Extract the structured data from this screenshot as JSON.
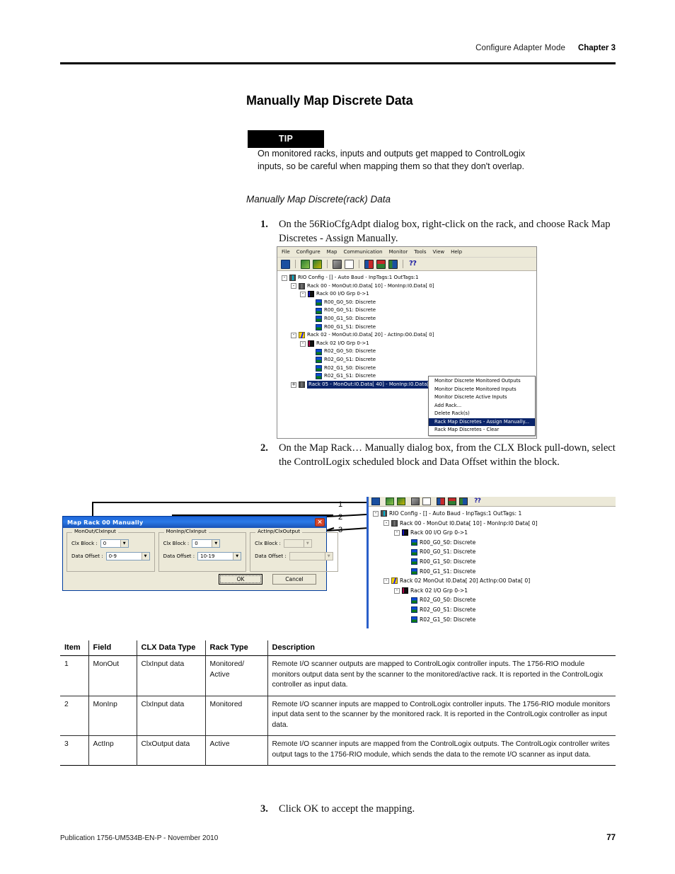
{
  "header": {
    "section": "Configure Adapter Mode",
    "chapter": "Chapter 3"
  },
  "page_title": "Manually Map Discrete Data",
  "tip": {
    "badge": "TIP",
    "text": "On monitored racks, inputs and outputs get mapped to ControlLogix inputs, so be careful when mapping them so that they don't overlap."
  },
  "subhead": "Manually Map Discrete(rack) Data",
  "steps": [
    {
      "num": "1.",
      "text": "On the 56RioCfgAdpt dialog box, right-click on the rack, and choose Rack Map Discretes - Assign Manually."
    },
    {
      "num": "2.",
      "text": "On the Map Rack… Manually dialog box, from the CLX Block pull-down, select the ControlLogix scheduled block and Data Offset within the block."
    },
    {
      "num": "3.",
      "text": "Click OK to accept the mapping."
    }
  ],
  "figure1": {
    "menus": [
      "File",
      "Configure",
      "Map",
      "Communication",
      "Monitor",
      "Tools",
      "View",
      "Help"
    ],
    "toolbar_icons": [
      "save-icon",
      "map-in-icon",
      "map-out-icon",
      "tools-icon",
      "report-icon",
      "monitor-in-icon",
      "monitor-out-icon",
      "connect-icon",
      "help-pointer-icon"
    ],
    "tree": [
      {
        "depth": 0,
        "expander": "-",
        "icon": "root",
        "label": "RIO Config - [] - Auto Baud - InpTags:1 OutTags:1"
      },
      {
        "depth": 1,
        "expander": "-",
        "icon": "rack",
        "label": "Rack 00 - MonOut:I0.Data[ 10] - MonInp:I0.Data[  0]"
      },
      {
        "depth": 2,
        "expander": "-",
        "icon": "grp",
        "label": "Rack 00 I/O Grp 0->1"
      },
      {
        "depth": 3,
        "expander": "",
        "icon": "disc",
        "label": "R00_G0_S0: Discrete"
      },
      {
        "depth": 3,
        "expander": "",
        "icon": "disc",
        "label": "R00_G0_S1: Discrete"
      },
      {
        "depth": 3,
        "expander": "",
        "icon": "disc",
        "label": "R00_G1_S0: Discrete"
      },
      {
        "depth": 3,
        "expander": "",
        "icon": "disc",
        "label": "R00_G1_S1: Discrete"
      },
      {
        "depth": 1,
        "expander": "-",
        "icon": "active",
        "label": "Rack 02 - MonOut:I0.Data[ 20] - ActInp:O0.Data[  0]"
      },
      {
        "depth": 2,
        "expander": "-",
        "icon": "grp-r",
        "label": "Rack 02 I/O Grp 0->1"
      },
      {
        "depth": 3,
        "expander": "",
        "icon": "disc",
        "label": "R02_G0_S0: Discrete"
      },
      {
        "depth": 3,
        "expander": "",
        "icon": "disc",
        "label": "R02_G0_S1: Discrete"
      },
      {
        "depth": 3,
        "expander": "",
        "icon": "disc",
        "label": "R02_G1_S0: Discrete"
      },
      {
        "depth": 3,
        "expander": "",
        "icon": "disc",
        "label": "R02_G1_S1: Discrete"
      },
      {
        "depth": 1,
        "expander": "+",
        "icon": "rack",
        "label": "Rack 05 - MonOut:I0.Data[ 40] - MonInp:I0.Data[ 3",
        "selected": true
      }
    ],
    "context_menu": [
      {
        "label": "Monitor Discrete Monitored Outputs",
        "highlighted": false
      },
      {
        "label": "Monitor Discrete Monitored Inputs",
        "highlighted": false
      },
      {
        "label": "Monitor Discrete Active Inputs",
        "highlighted": false
      },
      {
        "label": "Add Rack...",
        "highlighted": false
      },
      {
        "label": "Delete Rack(s)",
        "highlighted": false
      },
      {
        "label": "Rack Map Discretes - Assign Manually...",
        "highlighted": true
      },
      {
        "label": "Rack Map Discretes - Clear",
        "highlighted": false
      }
    ]
  },
  "dialog": {
    "title": "Map Rack 00 Manually",
    "close_label": "×",
    "groups": [
      {
        "legend": "MonOut/ClxInput",
        "block_label": "Clx Block :",
        "block_value": "0",
        "offset_label": "Data Offset :",
        "offset_value": "0-9",
        "disabled": false
      },
      {
        "legend": "MonInp/ClxInput",
        "block_label": "Clx Block :",
        "block_value": "0",
        "offset_label": "Data Offset :",
        "offset_value": "10-19",
        "disabled": false
      },
      {
        "legend": "ActInp/ClxOutput",
        "block_label": "Clx Block :",
        "block_value": "",
        "offset_label": "Data Offset :",
        "offset_value": "",
        "disabled": true
      }
    ],
    "ok_label": "OK",
    "cancel_label": "Cancel"
  },
  "figure2": {
    "tree": [
      {
        "depth": 0,
        "expander": "-",
        "icon": "root",
        "label": "RIO Config - [] - Auto Baud - InpTags:1 OutTags: 1"
      },
      {
        "depth": 1,
        "expander": "-",
        "icon": "rack",
        "label": "Rack 00 - MonOut I0.Data[ 10] - MonInp:I0 Data[  0]"
      },
      {
        "depth": 2,
        "expander": "-",
        "icon": "grp",
        "label": "Rack 00 I/O Grp 0->1"
      },
      {
        "depth": 3,
        "expander": "",
        "icon": "disc",
        "label": "R00_G0_S0: Discrete"
      },
      {
        "depth": 3,
        "expander": "",
        "icon": "disc",
        "label": "R00_G0_S1: Discrete"
      },
      {
        "depth": 3,
        "expander": "",
        "icon": "disc",
        "label": "R00_G1_S0: Discrete"
      },
      {
        "depth": 3,
        "expander": "",
        "icon": "disc",
        "label": "R00_G1_S1: Discrete"
      },
      {
        "depth": 1,
        "expander": "-",
        "icon": "active",
        "label": "Rack 02   MonOut I0.Data[ 20]   ActInp:O0 Data[  0]"
      },
      {
        "depth": 2,
        "expander": "-",
        "icon": "grp-r",
        "label": "Rack 02 I/O Grp 0->1"
      },
      {
        "depth": 3,
        "expander": "",
        "icon": "disc",
        "label": "R02_G0_S0: Discrete"
      },
      {
        "depth": 3,
        "expander": "",
        "icon": "disc",
        "label": "R02_G0_S1: Discrete"
      },
      {
        "depth": 3,
        "expander": "",
        "icon": "disc",
        "label": "R02_G1_S0: Discrete"
      }
    ]
  },
  "callouts": [
    "1",
    "2",
    "3"
  ],
  "table": {
    "headers": [
      "Item",
      "Field",
      "CLX Data Type",
      "Rack Type",
      "Description"
    ],
    "rows": [
      {
        "item": "1",
        "field": "MonOut",
        "clx_data_type": "ClxInput data",
        "rack_type": "Monitored/ Active",
        "description": "Remote I/O scanner outputs are mapped to ControlLogix controller inputs. The 1756-RIO module monitors output data sent by the scanner to the monitored/active rack. It is reported in the ControlLogix controller as input data."
      },
      {
        "item": "2",
        "field": "MonInp",
        "clx_data_type": "ClxInput data",
        "rack_type": "Monitored",
        "description": "Remote I/O scanner inputs are mapped to ControlLogix controller inputs. The 1756-RIO module monitors input data sent to the scanner by the monitored rack. It is reported in the ControlLogix controller as input data."
      },
      {
        "item": "3",
        "field": "ActInp",
        "clx_data_type": "ClxOutput data",
        "rack_type": "Active",
        "description": "Remote I/O scanner inputs are mapped from the ControlLogix outputs. The ControlLogix controller writes output tags to the 1756-RIO module, which sends the data to the remote I/O scanner as input data."
      }
    ]
  },
  "footer": {
    "publication": "Publication 1756-UM534B-EN-P - November 2010",
    "page_number": "77"
  }
}
